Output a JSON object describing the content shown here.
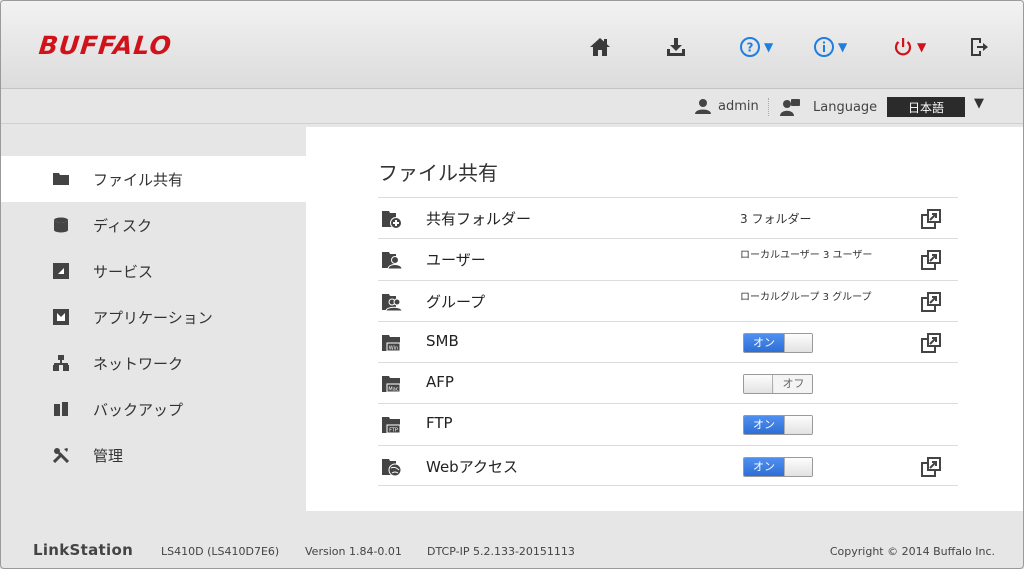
{
  "header": {
    "logo": "BUFFALO",
    "icons": [
      "home-icon",
      "download-icon",
      "help-icon",
      "info-icon",
      "power-icon",
      "logout-icon"
    ],
    "caret": "▼",
    "colors": {
      "logo": "#d0121b",
      "blue": "#1f7fe0",
      "red": "#d0121b"
    }
  },
  "subbar": {
    "username": "admin",
    "language_label": "Language",
    "language_value": "日本語",
    "caret": "▼"
  },
  "sidebar": {
    "items": [
      {
        "label": "ファイル共有",
        "icon": "folder-icon",
        "active": true
      },
      {
        "label": "ディスク",
        "icon": "disk-icon",
        "active": false
      },
      {
        "label": "サービス",
        "icon": "service-icon",
        "active": false
      },
      {
        "label": "アプリケーション",
        "icon": "application-icon",
        "active": false
      },
      {
        "label": "ネットワーク",
        "icon": "network-icon",
        "active": false
      },
      {
        "label": "バックアップ",
        "icon": "backup-icon",
        "active": false
      },
      {
        "label": "管理",
        "icon": "tools-icon",
        "active": false
      }
    ]
  },
  "main": {
    "title": "ファイル共有",
    "rows": [
      {
        "name": "共有フォルダー",
        "icon": "shared-folder-icon",
        "value": "3 フォルダー",
        "ext": true
      },
      {
        "name": "ユーザー",
        "icon": "user-folder-icon",
        "value": "ローカルユーザー 3 ユーザー",
        "ext": true
      },
      {
        "name": "グループ",
        "icon": "group-folder-icon",
        "value": "ローカルグループ 3 グループ",
        "ext": true
      },
      {
        "name": "SMB",
        "icon": "smb-folder-icon",
        "toggle": "on",
        "toggle_label": "オン",
        "ext": true
      },
      {
        "name": "AFP",
        "icon": "afp-folder-icon",
        "toggle": "off",
        "toggle_label": "オフ",
        "ext": false
      },
      {
        "name": "FTP",
        "icon": "ftp-folder-icon",
        "toggle": "on",
        "toggle_label": "オン",
        "ext": false
      },
      {
        "name": "Webアクセス",
        "icon": "web-folder-icon",
        "toggle": "on",
        "toggle_label": "オン",
        "ext": true
      }
    ]
  },
  "footer": {
    "brand": "LinkStation",
    "model": "LS410D (LS410D7E6)",
    "version": "Version 1.84-0.01",
    "dtcp": "DTCP-IP 5.2.133-20151113",
    "copyright": "Copyright © 2014 Buffalo Inc."
  }
}
